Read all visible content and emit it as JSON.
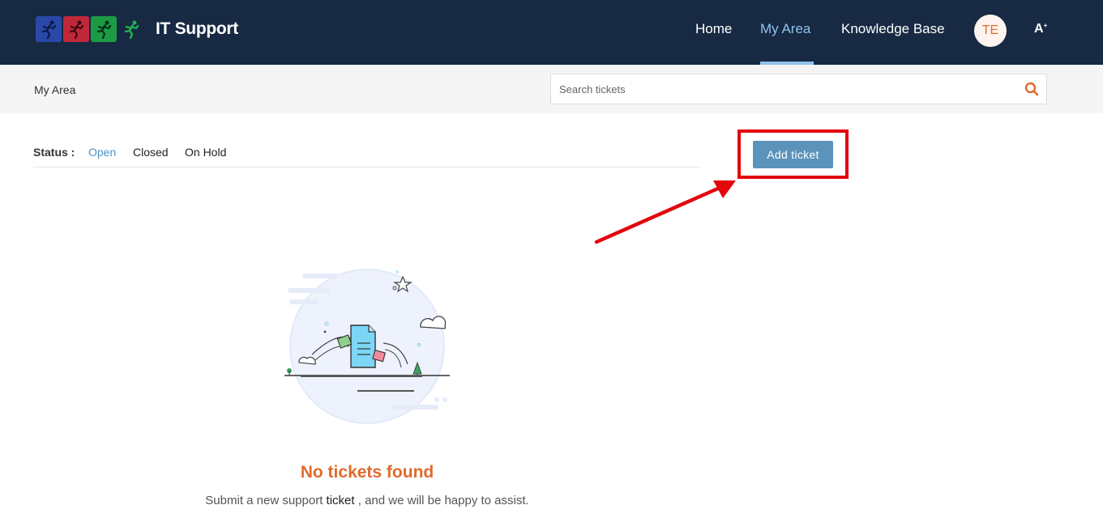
{
  "header": {
    "app_title": "IT Support",
    "nav": [
      {
        "label": "Home",
        "active": false
      },
      {
        "label": "My Area",
        "active": true
      },
      {
        "label": "Knowledge Base",
        "active": false
      }
    ],
    "avatar_initials": "TE",
    "font_toggle": "A",
    "colors": {
      "bar": "#172943",
      "active": "#8ec3ec",
      "accent": "#e06a2c"
    }
  },
  "subbar": {
    "breadcrumb": "My Area",
    "search": {
      "placeholder": "Search tickets",
      "value": ""
    }
  },
  "status": {
    "label": "Status :",
    "options": [
      {
        "label": "Open",
        "active": true
      },
      {
        "label": "Closed",
        "active": false
      },
      {
        "label": "On Hold",
        "active": false
      }
    ]
  },
  "actions": {
    "add_ticket": "Add ticket"
  },
  "empty_state": {
    "title": "No tickets found",
    "message_before": "Submit a new support",
    "message_keyword": "ticket",
    "message_after": ", and we will be happy to assist."
  }
}
